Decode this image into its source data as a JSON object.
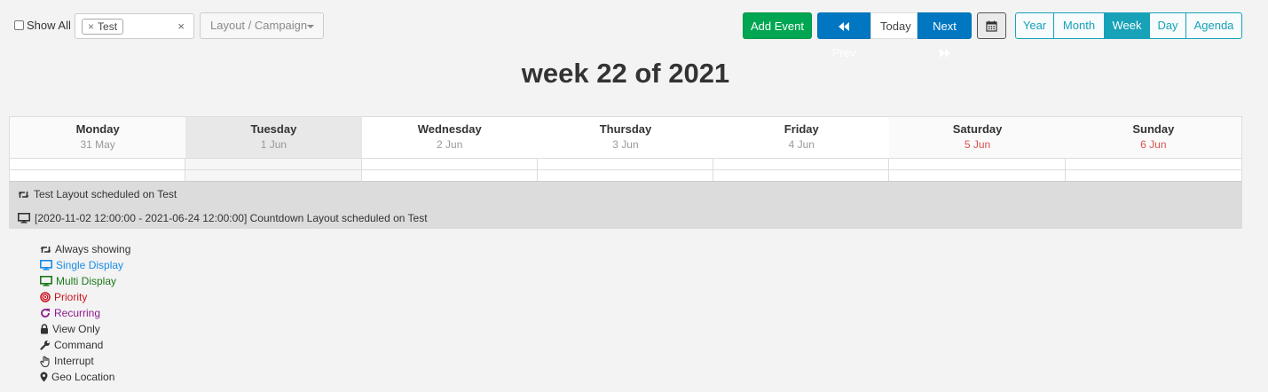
{
  "toolbar": {
    "show_all_label": "Show All",
    "tag_value": "Test",
    "tag_remove_glyph": "×",
    "tag_clear_glyph": "×",
    "layout_campaign_placeholder": "Layout / Campaign",
    "add_event_label": "Add Event",
    "prev_label": "Prev",
    "today_label": "Today",
    "next_label": "Next",
    "calendar_icon": "calendar-icon",
    "views": [
      "Year",
      "Month",
      "Week",
      "Day",
      "Agenda"
    ],
    "active_view": "Week"
  },
  "title": "week 22 of 2021",
  "days": [
    {
      "name": "Monday",
      "date": "31 May"
    },
    {
      "name": "Tuesday",
      "date": "1 Jun"
    },
    {
      "name": "Wednesday",
      "date": "2 Jun"
    },
    {
      "name": "Thursday",
      "date": "3 Jun"
    },
    {
      "name": "Friday",
      "date": "4 Jun"
    },
    {
      "name": "Saturday",
      "date": "5 Jun"
    },
    {
      "name": "Sunday",
      "date": "6 Jun"
    }
  ],
  "events": [
    {
      "icon": "retweet-icon",
      "text": "Test Layout scheduled on Test"
    },
    {
      "icon": "display-icon",
      "text": "[2020-11-02 12:00:00 - 2021-06-24 12:00:00] Countdown Layout scheduled on Test"
    }
  ],
  "legend": [
    {
      "icon": "retweet-icon",
      "label": "Always showing",
      "color": "#333333"
    },
    {
      "icon": "display-icon",
      "label": "Single Display",
      "color": "#1a8ce6"
    },
    {
      "icon": "display-icon",
      "label": "Multi Display",
      "color": "#1b7a1b"
    },
    {
      "icon": "bullseye-icon",
      "label": "Priority",
      "color": "#c9141e"
    },
    {
      "icon": "refresh-icon",
      "label": "Recurring",
      "color": "#8e1c8e"
    },
    {
      "icon": "lock-icon",
      "label": "View Only",
      "color": "#333333"
    },
    {
      "icon": "wrench-icon",
      "label": "Command",
      "color": "#333333"
    },
    {
      "icon": "hand-icon",
      "label": "Interrupt",
      "color": "#333333"
    },
    {
      "icon": "map-marker-icon",
      "label": "Geo Location",
      "color": "#333333"
    }
  ]
}
